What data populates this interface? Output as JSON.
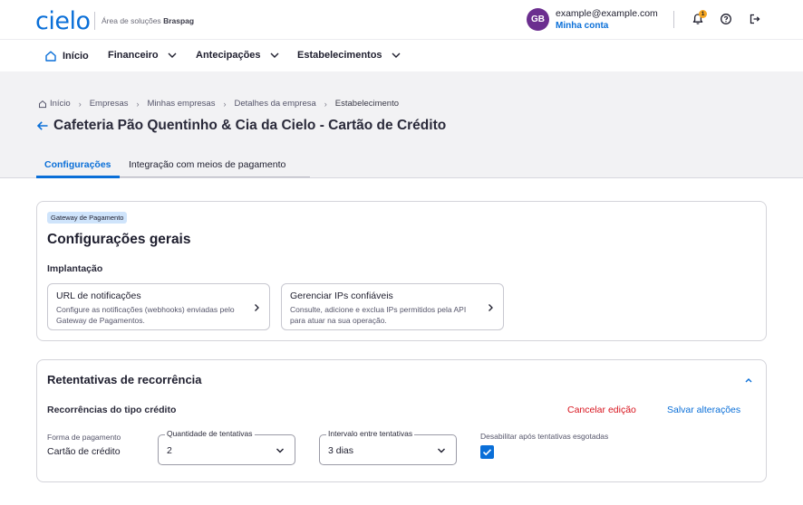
{
  "header": {
    "logo": "cielo",
    "subtitle_prefix": "Área de soluções",
    "subtitle_brand": "Braspag",
    "avatar_initials": "GB",
    "user_email": "example@example.com",
    "account_link": "Minha conta",
    "notification_count": "1"
  },
  "nav": {
    "items": [
      "Início",
      "Financeiro",
      "Antecipações",
      "Estabelecimentos"
    ]
  },
  "breadcrumb": [
    "Início",
    "Empresas",
    "Minhas empresas",
    "Detalhes da empresa",
    "Estabelecimento"
  ],
  "page": {
    "title": "Cafeteria Pão Quentinho & Cia da Cielo - Cartão de Crédito"
  },
  "tabs": [
    "Configurações",
    "Integração com meios de pagamento"
  ],
  "general": {
    "chip": "Gateway de Pagamento",
    "title": "Configurações gerais",
    "section": "Implantação",
    "cards": [
      {
        "title": "URL de notificações",
        "description": "Configure as notificações (webhooks) enviadas pelo Gateway de Pagamentos."
      },
      {
        "title": "Gerenciar IPs confiáveis",
        "description": "Consulte, adicione e exclua IPs permitidos pela API para atuar na sua operação."
      }
    ]
  },
  "retry": {
    "title": "Retentativas de recorrência",
    "subtitle": "Recorrências do tipo crédito",
    "cancel_label": "Cancelar edição",
    "save_label": "Salvar alterações",
    "payment_label": "Forma de pagamento",
    "payment_value": "Cartão de crédito",
    "attempts_legend": "Quantidade de tentativas",
    "attempts_value": "2",
    "interval_legend": "Intervalo entre tentativas",
    "interval_value": "3 dias",
    "disable_label": "Desabilitar após tentativas esgotadas",
    "disable_checked": true
  },
  "colors": {
    "brand_blue": "#0a6fd8",
    "danger_red": "#d8141e",
    "avatar_purple": "#6b2e8f"
  }
}
